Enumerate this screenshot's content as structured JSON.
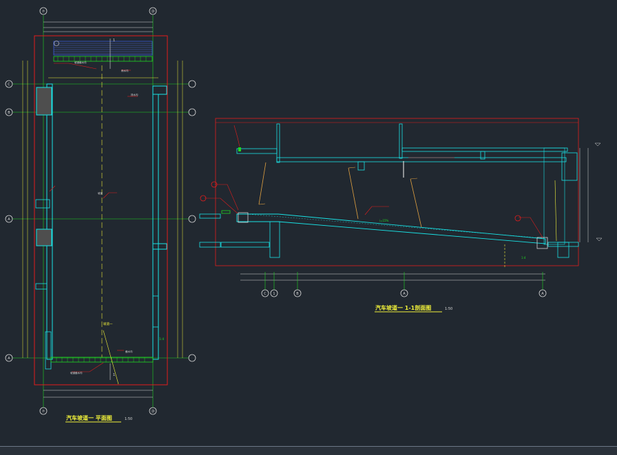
{
  "colors": {
    "background": "#212830",
    "wall": "#19e3e6",
    "hatch": "#5a5a5a",
    "outline_red": "#e21d1d",
    "dim_green": "#21d921",
    "text_yellow": "#f2f23a",
    "axis_white": "#d9d9d9",
    "ramp_orange": "#e0a040"
  },
  "plan": {
    "title": "汽车坡道一 平面图",
    "scale": "1:50",
    "axis_top_left": "⑦",
    "axis_top_right": "⑳",
    "axis_bottom_left": "⑦",
    "axis_bottom_right": "⑳",
    "axis_row_1": "C",
    "axis_row_2": "B",
    "axis_row_3": "A",
    "axis_row_4": "A",
    "label_ramp": "坡道一",
    "label_section": "1",
    "label_slope": "1:4"
  },
  "section": {
    "title": "汽车坡道一 1-1剖面图",
    "scale": "1:50",
    "axis_1": "C",
    "axis_2": "1",
    "axis_3": "B",
    "axis_4": "A",
    "axis_5": "A",
    "label_slope": "i=15%",
    "label_ratio": "1:4"
  },
  "icons": {
    "axis_bubble": "axis-bubble-icon",
    "section_mark": "section-mark-icon",
    "level_mark": "level-mark-icon"
  }
}
